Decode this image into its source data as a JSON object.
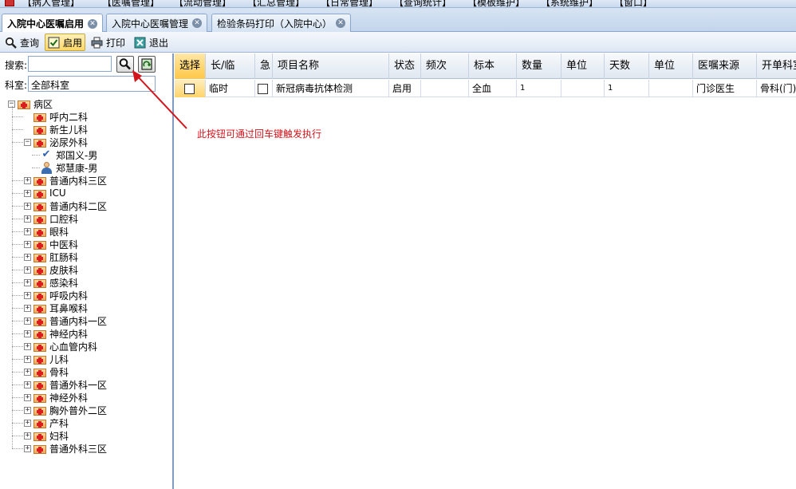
{
  "menubar": {
    "items": [
      "【病人管理】",
      "【医嘱管理】",
      "【流动管理】",
      "【汇总管理】",
      "【日常管理】",
      "【查询统计】",
      "【模板维护】",
      "【系统维护】",
      "【窗口】"
    ]
  },
  "tabs": [
    {
      "label": "入院中心医嘱启用"
    },
    {
      "label": "入院中心医嘱管理"
    },
    {
      "label": "检验条码打印（入院中心）"
    }
  ],
  "toolbar": {
    "query_label": "查询",
    "enable_label": "启用",
    "print_label": "打印",
    "exit_label": "退出"
  },
  "leftpanel": {
    "search_label": "搜索:",
    "search_value": "",
    "dept_label": "科室:",
    "dept_value": "全部科室"
  },
  "tree": {
    "root": "病区",
    "items": [
      {
        "label": "呼内二科",
        "type": "dept",
        "expander": "leaf"
      },
      {
        "label": "新生儿科",
        "type": "dept",
        "expander": "leaf"
      },
      {
        "label": "泌尿外科",
        "type": "dept",
        "expander": "minus"
      },
      {
        "label": "郑国义-男",
        "type": "patient-check"
      },
      {
        "label": "郑慧康-男",
        "type": "patient"
      },
      {
        "label": "普通内科三区",
        "type": "dept",
        "expander": "plus"
      },
      {
        "label": "ICU",
        "type": "dept",
        "expander": "plus"
      },
      {
        "label": "普通内科二区",
        "type": "dept",
        "expander": "plus"
      },
      {
        "label": "口腔科",
        "type": "dept",
        "expander": "plus"
      },
      {
        "label": "眼科",
        "type": "dept",
        "expander": "plus"
      },
      {
        "label": "中医科",
        "type": "dept",
        "expander": "plus"
      },
      {
        "label": "肛肠科",
        "type": "dept",
        "expander": "plus"
      },
      {
        "label": "皮肤科",
        "type": "dept",
        "expander": "plus"
      },
      {
        "label": "感染科",
        "type": "dept",
        "expander": "plus"
      },
      {
        "label": "呼吸内科",
        "type": "dept",
        "expander": "plus"
      },
      {
        "label": "耳鼻喉科",
        "type": "dept",
        "expander": "plus"
      },
      {
        "label": "普通内科一区",
        "type": "dept",
        "expander": "plus"
      },
      {
        "label": "神经内科",
        "type": "dept",
        "expander": "plus"
      },
      {
        "label": "心血管内科",
        "type": "dept",
        "expander": "plus"
      },
      {
        "label": "儿科",
        "type": "dept",
        "expander": "plus"
      },
      {
        "label": "骨科",
        "type": "dept",
        "expander": "plus"
      },
      {
        "label": "普通外科一区",
        "type": "dept",
        "expander": "plus"
      },
      {
        "label": "神经外科",
        "type": "dept",
        "expander": "plus"
      },
      {
        "label": "胸外普外二区",
        "type": "dept",
        "expander": "plus"
      },
      {
        "label": "产科",
        "type": "dept",
        "expander": "plus"
      },
      {
        "label": "妇科",
        "type": "dept",
        "expander": "plus"
      },
      {
        "label": "普通外科三区",
        "type": "dept",
        "expander": "plus"
      }
    ]
  },
  "grid": {
    "columns": [
      "选择",
      "长/临",
      "急",
      "项目名称",
      "状态",
      "频次",
      "标本",
      "数量",
      "单位",
      "天数",
      "单位",
      "医嘱来源",
      "开单科室"
    ],
    "rows": [
      {
        "type": "临时",
        "name": "新冠病毒抗体检测",
        "status": "启用",
        "freq": "",
        "specimen": "全血",
        "qty": "1",
        "unit": "",
        "days": "1",
        "unit2": "",
        "source": "门诊医生",
        "dept": "骨科(门)"
      }
    ]
  },
  "annotation": "此按钮可通过回车键触发执行",
  "colors": {
    "accent": "#ffc846",
    "annotation": "#d4141c",
    "border": "#8aa6cc"
  }
}
